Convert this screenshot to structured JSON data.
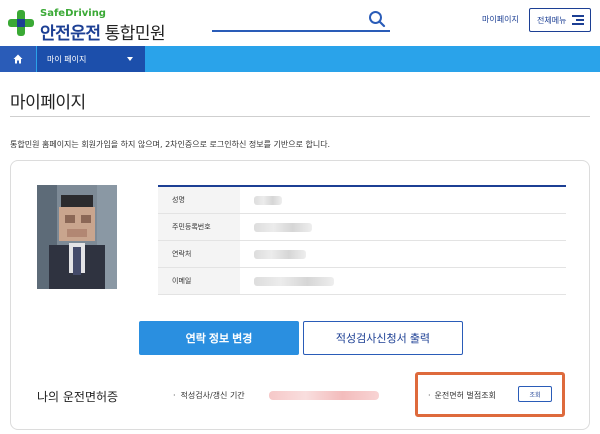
{
  "header": {
    "logo_en": "SafeDriving",
    "logo_ko_brand": "안전운전",
    "logo_ko_suffix": "통합민원",
    "mypage_link": "마이페이지",
    "all_menu_label": "전체메뉴"
  },
  "navbar": {
    "current_menu": "마이 페이지"
  },
  "page": {
    "title": "마이페이지",
    "intro": "통합민원 홈페이지는 회원가입을 하지 않으며, 2차인증으로 로그인하신 정보를 기반으로 합니다."
  },
  "profile": {
    "rows": [
      {
        "label": "성명"
      },
      {
        "label": "주민등록번호"
      },
      {
        "label": "연락처"
      },
      {
        "label": "이메일"
      }
    ]
  },
  "actions": {
    "change_contact": "연락 정보 변경",
    "print_aptitude": "적성검사신청서 출력"
  },
  "license": {
    "section_title": "나의 운전면허증",
    "period_label": "적성검사/갱신 기간",
    "penalty_label": "운전면허 벌점조회",
    "lookup_button": "조회"
  },
  "colors": {
    "brand_navy": "#1c3f94",
    "brand_green": "#3aa935",
    "nav_blue": "#2aa3ea",
    "primary_button": "#2a8fe0",
    "highlight_border": "#de6a3c"
  }
}
